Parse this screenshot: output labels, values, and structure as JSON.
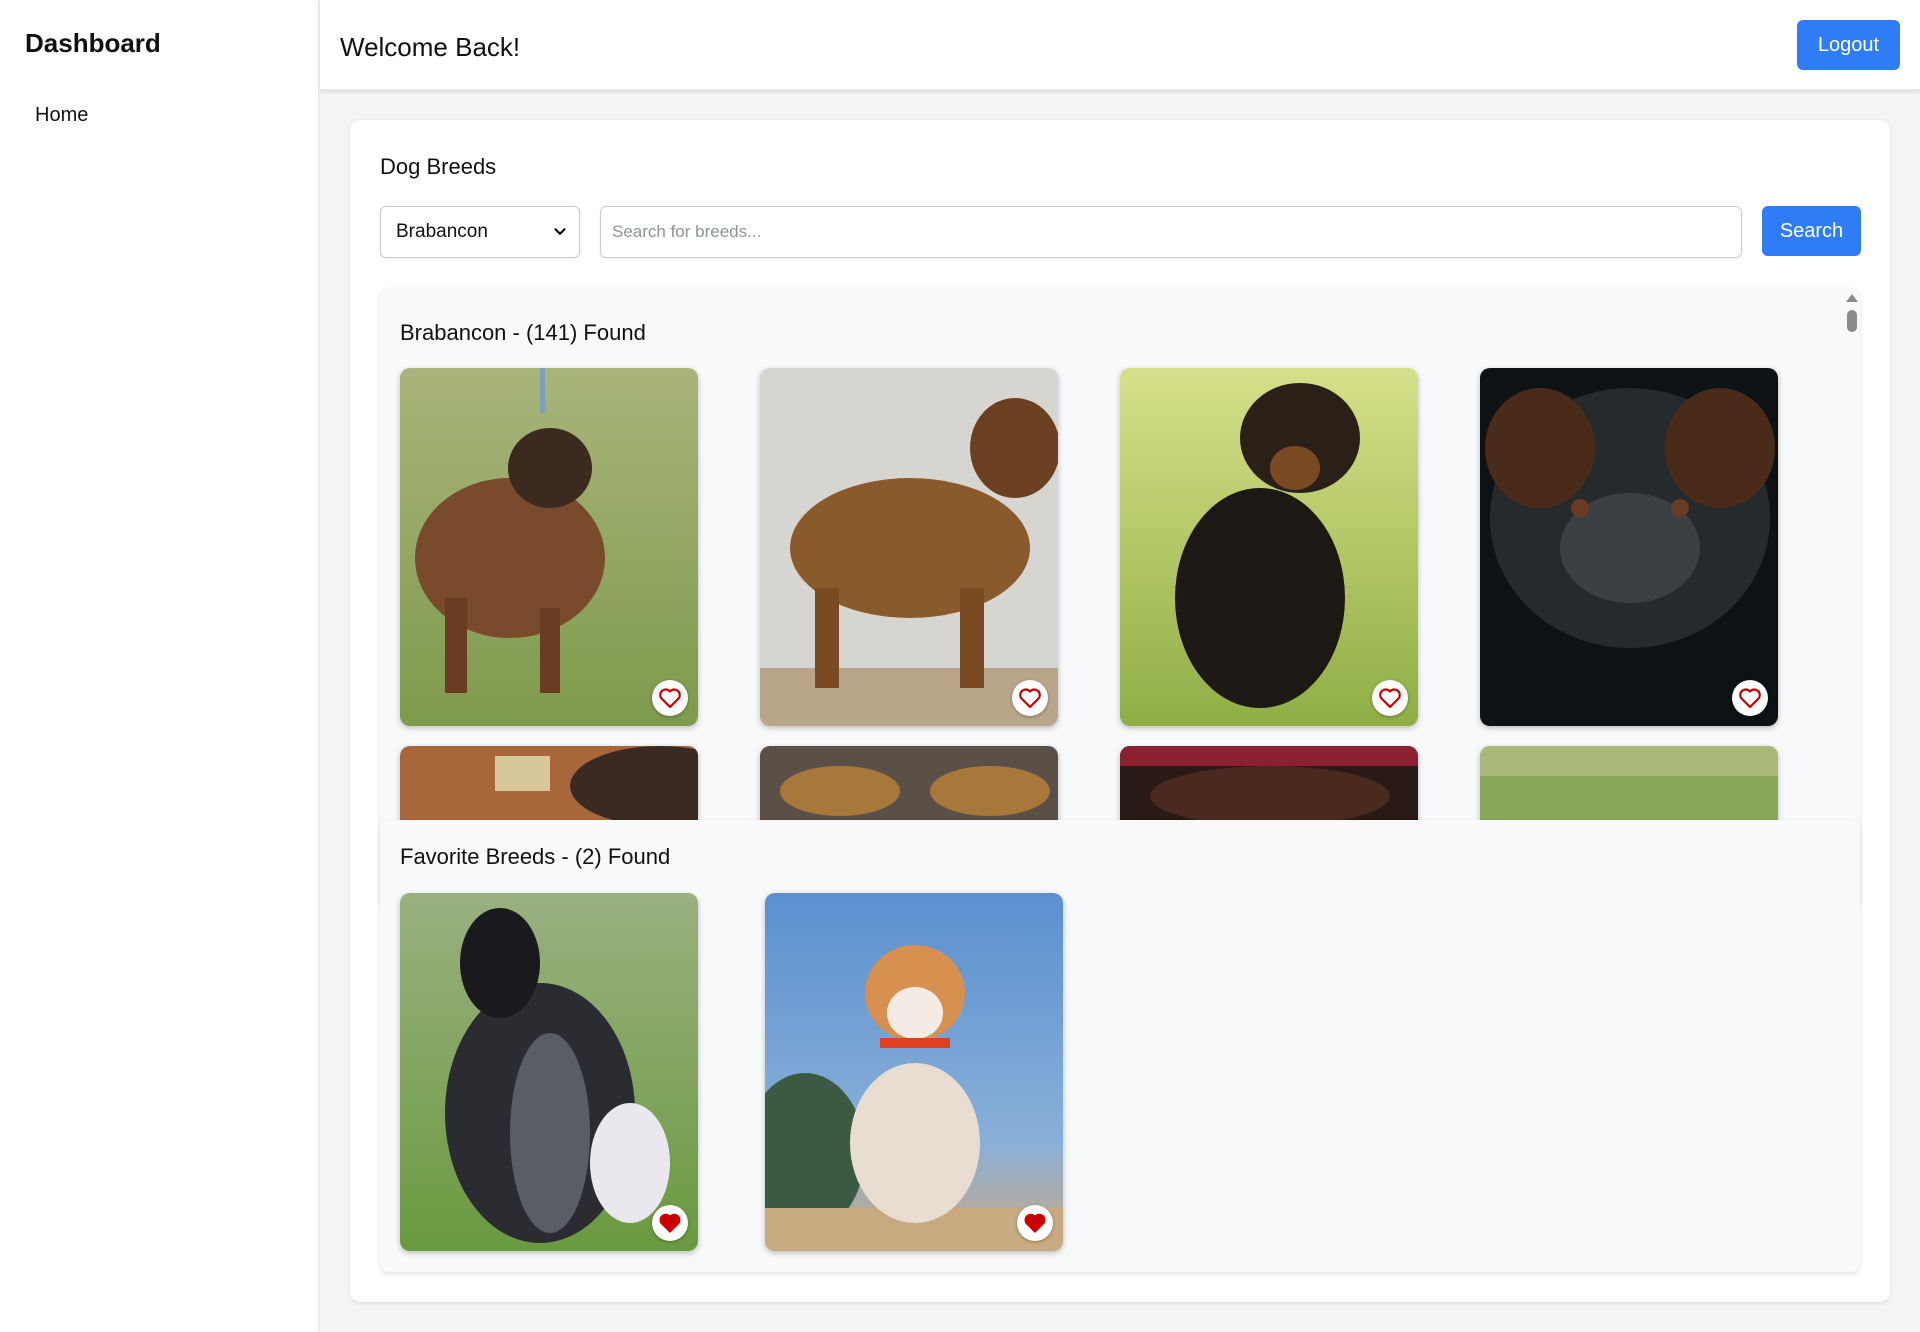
{
  "sidebar": {
    "title": "Dashboard",
    "items": [
      {
        "label": "Home"
      }
    ]
  },
  "header": {
    "welcome": "Welcome Back!",
    "logout_label": "Logout"
  },
  "main": {
    "title": "Dog Breeds",
    "breed_select": {
      "selected": "Brabancon"
    },
    "search": {
      "placeholder": "Search for breeds...",
      "value": "",
      "button_label": "Search"
    }
  },
  "results": {
    "title": "Brabancon - (141) Found",
    "images": [
      {
        "favorite": false
      },
      {
        "favorite": false
      },
      {
        "favorite": false
      },
      {
        "favorite": false
      },
      {
        "favorite": false
      },
      {
        "favorite": false
      },
      {
        "favorite": false
      },
      {
        "favorite": false
      }
    ]
  },
  "favorites": {
    "title": "Favorite Breeds - (2) Found",
    "images": [
      {
        "favorite": true
      },
      {
        "favorite": true
      }
    ]
  },
  "colors": {
    "accent": "#2f7df6",
    "heart": "#cc0000"
  },
  "icons": {
    "heart_outline": "heart-outline-icon",
    "heart_filled": "heart-filled-icon",
    "chevron": "chevron-down-icon"
  }
}
